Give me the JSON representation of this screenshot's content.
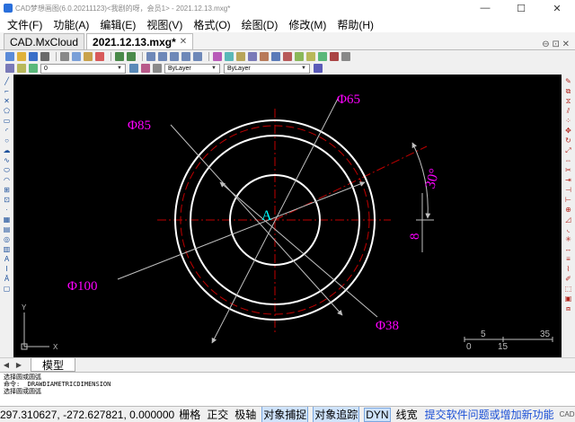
{
  "window": {
    "title": "CAD梦想画图(6.0.20211123)<我剧的呀，会员1> - 2021.12.13.mxg*",
    "minimize_glyph": "—",
    "maximize_glyph": "☐",
    "close_glyph": "✕"
  },
  "menu": [
    "文件(F)",
    "功能(A)",
    "编辑(E)",
    "视图(V)",
    "格式(O)",
    "绘图(D)",
    "修改(M)",
    "帮助(H)"
  ],
  "tabs": [
    {
      "label": "CAD.MxCloud",
      "active": false
    },
    {
      "label": "2021.12.13.mxg*",
      "active": true
    }
  ],
  "tab_close_glyph": "✕",
  "tab_bar_right": "⊖ ⊡ ✕",
  "toolbar2": {
    "layer": "0",
    "color": "ByLayer",
    "linetype": "ByLayer"
  },
  "drawing": {
    "dim_labels": [
      "Φ65",
      "Φ85",
      "Φ100",
      "Φ38",
      "30°",
      "8"
    ],
    "center_label": "A",
    "scale_numbers": [
      "5",
      "35",
      "0",
      "15"
    ],
    "ucs_x": "X",
    "ucs_y": "Y"
  },
  "layout": {
    "model_tab": "模型",
    "nav": [
      "◀",
      "▶"
    ]
  },
  "command_lines": [
    "选择圆或圆弧",
    "命令: _DRAWDIAMETRICDIMENSION",
    "选择圆或圆弧"
  ],
  "status": {
    "coords": "297.310627, -272.627821, 0.000000",
    "buttons": [
      {
        "label": "栅格",
        "on": false
      },
      {
        "label": "正交",
        "on": false
      },
      {
        "label": "极轴",
        "on": false
      },
      {
        "label": "对象捕捉",
        "on": true
      },
      {
        "label": "对象追踪",
        "on": true
      },
      {
        "label": "DYN",
        "on": true
      },
      {
        "label": "线宽",
        "on": false
      }
    ],
    "feedback_link": "提交软件问题或增加新功能",
    "brand": "CAD.MxCloud"
  },
  "colors": {
    "canvas_bg": "#000000",
    "circle": "#ffffff",
    "center_line": "#c00000",
    "dim_text": "#ff00ff",
    "dim_line": "#bfbfbf",
    "center_text": "#00ffff"
  }
}
